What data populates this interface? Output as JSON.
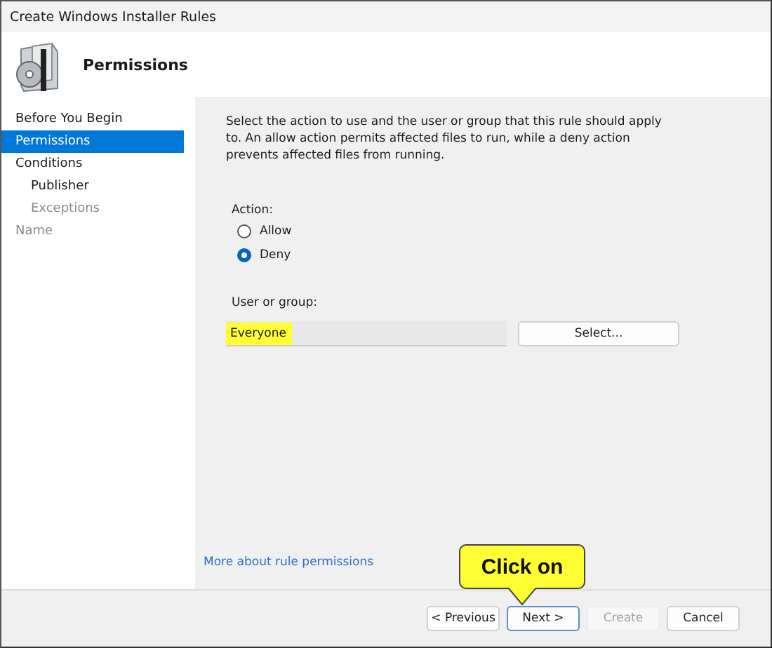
{
  "window": {
    "title": "Create Windows Installer Rules"
  },
  "header": {
    "title": "Permissions"
  },
  "sidebar": {
    "items": [
      {
        "label": "Before You Begin",
        "selected": false,
        "disabled": false
      },
      {
        "label": "Permissions",
        "selected": true,
        "disabled": false
      },
      {
        "label": "Conditions",
        "selected": false,
        "disabled": false,
        "children": [
          {
            "label": "Publisher",
            "selected": false,
            "disabled": false
          },
          {
            "label": "Exceptions",
            "selected": false,
            "disabled": true
          }
        ]
      },
      {
        "label": "Name",
        "selected": false,
        "disabled": true
      }
    ]
  },
  "description": "Select the action to use and the user or group that this rule should apply to. An allow action permits affected files to run, while a deny action prevents affected files from running.",
  "action": {
    "label": "Action:",
    "options": [
      {
        "label": "Allow",
        "selected": false
      },
      {
        "label": "Deny",
        "selected": true
      }
    ]
  },
  "user_or_group": {
    "label": "User or group:",
    "value": "Everyone",
    "highlighted": true,
    "button": "Select..."
  },
  "link": "More about rule permissions",
  "callout": {
    "text": "Click on"
  },
  "buttons": [
    {
      "label": "< Previous",
      "disabled": false,
      "focused": false
    },
    {
      "label": "Next >",
      "disabled": false,
      "focused": true
    },
    {
      "label": "Create",
      "disabled": true,
      "focused": false
    },
    {
      "label": "Cancel",
      "disabled": false,
      "focused": false
    }
  ]
}
